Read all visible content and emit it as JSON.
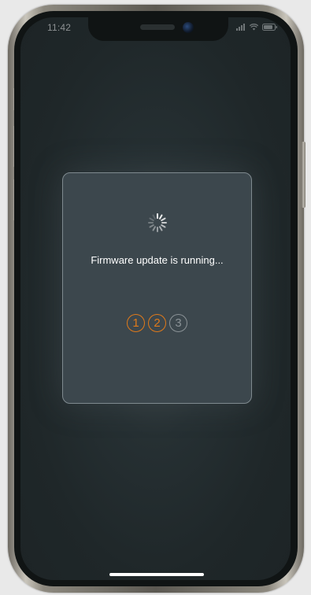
{
  "status_bar": {
    "time": "11:42",
    "icons": [
      "signal-icon",
      "wifi-icon",
      "battery-icon"
    ]
  },
  "dialog": {
    "message": "Firmware update is running...",
    "spinner": "loading-spinner-icon",
    "steps": [
      {
        "label": "1",
        "state": "done"
      },
      {
        "label": "2",
        "state": "done"
      },
      {
        "label": "3",
        "state": "pending"
      }
    ]
  },
  "colors": {
    "accent": "#e07a1a",
    "pending": "#8a9296",
    "dialog_bg": "#3c474d",
    "screen_bg": "#263033"
  }
}
